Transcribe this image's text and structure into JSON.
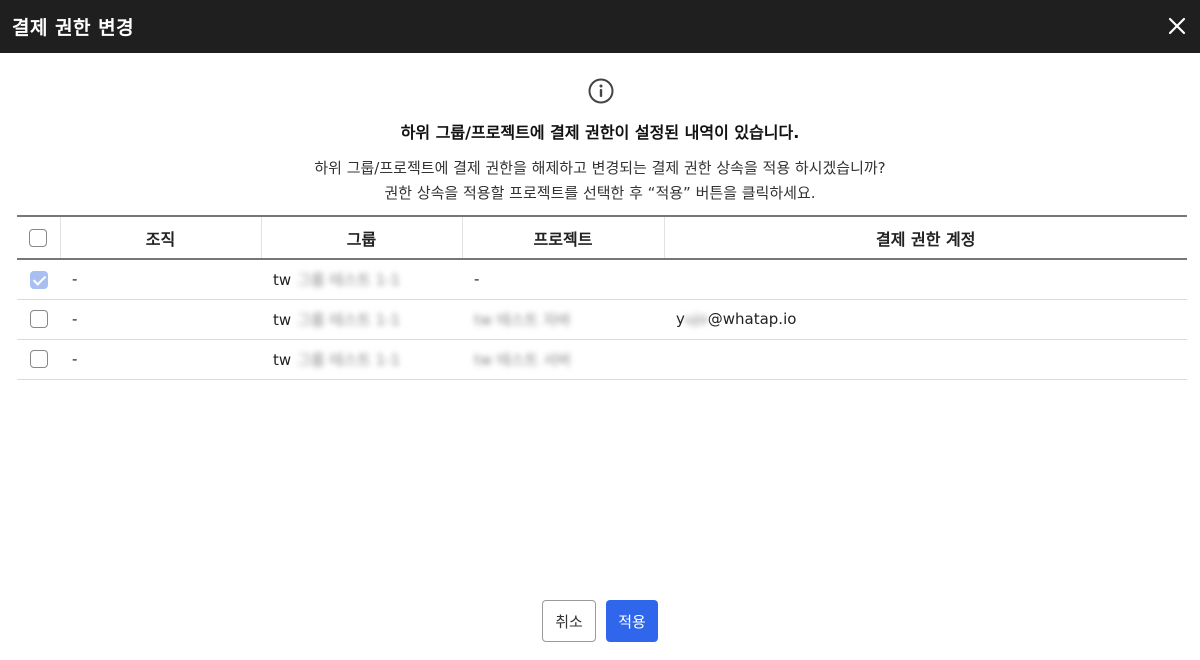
{
  "dialog": {
    "title": "결제 권한 변경",
    "close_icon": "close-icon",
    "info_icon": "info-circle-icon",
    "heading": "하위 그룹/프로젝트에 결제 권한이 설정된 내역이 있습니다.",
    "description_line1": "하위 그룹/프로젝트에 결제 권한을 해제하고 변경되는 결제 권한 상속을 적용 하시겠습니까?",
    "description_line2": "권한 상속을 적용할 프로젝트를 선택한 후 “적용” 버튼을 클릭하세요."
  },
  "table": {
    "columns": [
      "조직",
      "그룹",
      "프로젝트",
      "결제 권한 계정"
    ],
    "rows": [
      {
        "checked": true,
        "org": "-",
        "group_prefix": "tw",
        "group_blurred": "그룹 테스트 1-1",
        "project": "-",
        "project_blurred": "",
        "account_prefix": "",
        "account_blurred": "",
        "account_suffix": ""
      },
      {
        "checked": false,
        "org": "-",
        "group_prefix": "tw",
        "group_blurred": "그룹 테스트 1-1",
        "project": "",
        "project_blurred": "tw 테스트 자바",
        "account_prefix": "y",
        "account_blurred": "ujo",
        "account_suffix": "@whatap.io"
      },
      {
        "checked": false,
        "org": "-",
        "group_prefix": "tw",
        "group_blurred": "그룹 테스트 1-1",
        "project": "",
        "project_blurred": "tw 테스트 서버",
        "account_prefix": "",
        "account_blurred": "",
        "account_suffix": ""
      }
    ]
  },
  "footer": {
    "cancel_label": "취소",
    "apply_label": "적용"
  },
  "colors": {
    "titlebar": "#1f1f1f",
    "apply_button": "#2f66ec",
    "checked_checkbox": "#a9bff2"
  }
}
